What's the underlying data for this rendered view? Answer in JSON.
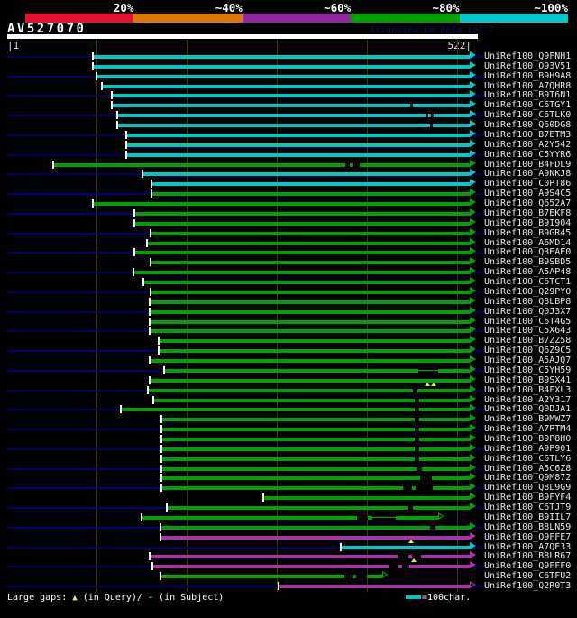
{
  "scale_bar": {
    "segments": [
      {
        "label": "20%",
        "color": "#e81030"
      },
      {
        "label": "~40%",
        "color": "#d97700"
      },
      {
        "label": "~60%",
        "color": "#8e2a9e"
      },
      {
        "label": "~80%",
        "color": "#00a000"
      },
      {
        "label": "~100%",
        "color": "#00c8c8"
      }
    ]
  },
  "header": {
    "query_id": "AV527070",
    "credit": "AlignView.pm Beta rel.7"
  },
  "ruler": {
    "start_label": "|1",
    "end_label": "522|",
    "query_length": 522
  },
  "colors": {
    "cyan": "#00c8c8",
    "green": "#00a000",
    "magenta": "#aa33aa",
    "query_line": "#000066",
    "gridline": "#3a3a00",
    "gap_marker_yellow": "#e8e860"
  },
  "footer": {
    "prefix": "Large gaps:",
    "query_marker": "▲",
    "query_text": "(in Query)/",
    "subject_marker": "-",
    "subject_text": " (in Subject)",
    "scale_text": "=100char."
  },
  "alignments": [
    {
      "id": "UniRef100_Q9FNH1",
      "identity": "cyan",
      "start": 103,
      "end": 521,
      "gaps": [],
      "markers": [],
      "hollow": false
    },
    {
      "id": "UniRef100_Q93V51",
      "identity": "cyan",
      "start": 103,
      "end": 521,
      "gaps": [],
      "markers": [],
      "hollow": false
    },
    {
      "id": "UniRef100_B9H9A8",
      "identity": "cyan",
      "start": 107,
      "end": 521,
      "gaps": [],
      "markers": [],
      "hollow": false
    },
    {
      "id": "UniRef100_A7QHR8",
      "identity": "cyan",
      "start": 113,
      "end": 521,
      "gaps": [],
      "markers": [],
      "hollow": false
    },
    {
      "id": "UniRef100_B9T6N1",
      "identity": "cyan",
      "start": 124,
      "end": 521,
      "gaps": [],
      "markers": [],
      "hollow": false
    },
    {
      "id": "UniRef100_C6TGY1",
      "identity": "cyan",
      "start": 124,
      "end": 521,
      "gaps": [
        [
          455,
          3
        ]
      ],
      "markers": [],
      "hollow": false
    },
    {
      "id": "UniRef100_C6TLK0",
      "identity": "cyan",
      "start": 130,
      "end": 521,
      "gaps": [
        [
          472,
          3
        ],
        [
          478,
          3
        ]
      ],
      "markers": [],
      "hollow": false
    },
    {
      "id": "UniRef100_Q60DG8",
      "identity": "cyan",
      "start": 130,
      "end": 521,
      "gaps": [
        [
          477,
          3
        ]
      ],
      "markers": [],
      "hollow": false
    },
    {
      "id": "UniRef100_B7ETM3",
      "identity": "cyan",
      "start": 140,
      "end": 521,
      "gaps": [],
      "markers": [],
      "hollow": false
    },
    {
      "id": "UniRef100_A2Y542",
      "identity": "cyan",
      "start": 140,
      "end": 521,
      "gaps": [],
      "markers": [],
      "hollow": false
    },
    {
      "id": "UniRef100_C5YYR6",
      "identity": "cyan",
      "start": 140,
      "end": 521,
      "gaps": [],
      "markers": [],
      "hollow": false
    },
    {
      "id": "UniRef100_B4FDL9",
      "identity": "green",
      "start": 59,
      "end": 521,
      "gaps": [
        [
          383,
          5
        ],
        [
          391,
          8
        ]
      ],
      "markers": [],
      "hollow": false
    },
    {
      "id": "UniRef100_A9NKJ8",
      "identity": "cyan",
      "start": 158,
      "end": 521,
      "gaps": [],
      "markers": [],
      "hollow": false
    },
    {
      "id": "UniRef100_C0PT86",
      "identity": "cyan",
      "start": 168,
      "end": 521,
      "gaps": [],
      "markers": [],
      "hollow": false
    },
    {
      "id": "UniRef100_A9S4C5",
      "identity": "green",
      "start": 168,
      "end": 521,
      "gaps": [],
      "markers": [],
      "hollow": false
    },
    {
      "id": "UniRef100_Q652A7",
      "identity": "green",
      "start": 103,
      "end": 521,
      "gaps": [],
      "markers": [],
      "hollow": false
    },
    {
      "id": "UniRef100_B7EKF8",
      "identity": "green",
      "start": 149,
      "end": 521,
      "gaps": [],
      "markers": [],
      "hollow": false
    },
    {
      "id": "UniRef100_B9I904",
      "identity": "green",
      "start": 149,
      "end": 521,
      "gaps": [],
      "markers": [],
      "hollow": false
    },
    {
      "id": "UniRef100_B9GR45",
      "identity": "green",
      "start": 167,
      "end": 521,
      "gaps": [],
      "markers": [],
      "hollow": false
    },
    {
      "id": "UniRef100_A6MD14",
      "identity": "green",
      "start": 163,
      "end": 521,
      "gaps": [],
      "markers": [],
      "hollow": false
    },
    {
      "id": "UniRef100_Q3EAE0",
      "identity": "green",
      "start": 149,
      "end": 521,
      "gaps": [],
      "markers": [],
      "hollow": false
    },
    {
      "id": "UniRef100_B9SBD5",
      "identity": "green",
      "start": 167,
      "end": 521,
      "gaps": [],
      "markers": [],
      "hollow": false
    },
    {
      "id": "UniRef100_A5AP48",
      "identity": "green",
      "start": 148,
      "end": 521,
      "gaps": [],
      "markers": [],
      "hollow": false
    },
    {
      "id": "UniRef100_C6TCT1",
      "identity": "green",
      "start": 159,
      "end": 521,
      "gaps": [],
      "markers": [],
      "hollow": false
    },
    {
      "id": "UniRef100_Q29PY0",
      "identity": "green",
      "start": 167,
      "end": 521,
      "gaps": [],
      "markers": [],
      "hollow": false
    },
    {
      "id": "UniRef100_Q8LBP8",
      "identity": "green",
      "start": 166,
      "end": 521,
      "gaps": [],
      "markers": [],
      "hollow": false
    },
    {
      "id": "UniRef100_Q0J3X7",
      "identity": "green",
      "start": 166,
      "end": 521,
      "gaps": [],
      "markers": [],
      "hollow": false
    },
    {
      "id": "UniRef100_C6T4G5",
      "identity": "green",
      "start": 166,
      "end": 521,
      "gaps": [],
      "markers": [],
      "hollow": false
    },
    {
      "id": "UniRef100_C5X643",
      "identity": "green",
      "start": 166,
      "end": 521,
      "gaps": [],
      "markers": [],
      "hollow": false
    },
    {
      "id": "UniRef100_B7ZZ58",
      "identity": "green",
      "start": 176,
      "end": 521,
      "gaps": [],
      "markers": [],
      "hollow": false
    },
    {
      "id": "UniRef100_Q6Z9C5",
      "identity": "green",
      "start": 176,
      "end": 521,
      "gaps": [],
      "markers": [],
      "hollow": false
    },
    {
      "id": "UniRef100_A5AJQ7",
      "identity": "green",
      "start": 166,
      "end": 521,
      "gaps": [],
      "markers": [],
      "hollow": false
    },
    {
      "id": "UniRef100_C5YH59",
      "identity": "green",
      "start": 182,
      "end": 521,
      "gaps": [
        [
          464,
          22,
          "line"
        ]
      ],
      "markers": [],
      "hollow": false
    },
    {
      "id": "UniRef100_B9SX41",
      "identity": "green",
      "start": 166,
      "end": 521,
      "gaps": [],
      "markers": [
        474,
        481
      ],
      "hollow": false
    },
    {
      "id": "UniRef100_B4FXL3",
      "identity": "green",
      "start": 164,
      "end": 521,
      "gaps": [
        [
          458,
          5
        ]
      ],
      "markers": [],
      "hollow": false
    },
    {
      "id": "UniRef100_A2Y317",
      "identity": "green",
      "start": 170,
      "end": 521,
      "gaps": [
        [
          460,
          5
        ]
      ],
      "markers": [],
      "hollow": false
    },
    {
      "id": "UniRef100_Q0DJA1",
      "identity": "green",
      "start": 134,
      "end": 521,
      "gaps": [
        [
          460,
          5
        ]
      ],
      "markers": [],
      "hollow": false
    },
    {
      "id": "UniRef100_B9MWZ7",
      "identity": "green",
      "start": 179,
      "end": 521,
      "gaps": [
        [
          460,
          5
        ]
      ],
      "markers": [],
      "hollow": false
    },
    {
      "id": "UniRef100_A7PTM4",
      "identity": "green",
      "start": 179,
      "end": 521,
      "gaps": [
        [
          460,
          5
        ]
      ],
      "markers": [],
      "hollow": false
    },
    {
      "id": "UniRef100_B9P8H0",
      "identity": "green",
      "start": 179,
      "end": 521,
      "gaps": [
        [
          460,
          5
        ]
      ],
      "markers": [],
      "hollow": false
    },
    {
      "id": "UniRef100_A9P901",
      "identity": "green",
      "start": 179,
      "end": 521,
      "gaps": [
        [
          460,
          5
        ]
      ],
      "markers": [],
      "hollow": false
    },
    {
      "id": "UniRef100_C6TLY6",
      "identity": "green",
      "start": 179,
      "end": 521,
      "gaps": [
        [
          460,
          5
        ]
      ],
      "markers": [],
      "hollow": false
    },
    {
      "id": "UniRef100_A5C6Z8",
      "identity": "green",
      "start": 179,
      "end": 521,
      "gaps": [
        [
          462,
          6
        ]
      ],
      "markers": [],
      "hollow": false
    },
    {
      "id": "UniRef100_Q9M872",
      "identity": "green",
      "start": 179,
      "end": 521,
      "gaps": [
        [
          466,
          13
        ]
      ],
      "markers": [],
      "hollow": false
    },
    {
      "id": "UniRef100_Q8L9G9",
      "identity": "green",
      "start": 179,
      "end": 521,
      "gaps": [
        [
          447,
          10
        ],
        [
          461,
          19
        ]
      ],
      "markers": [],
      "hollow": false
    },
    {
      "id": "UniRef100_B9FYF4",
      "identity": "green",
      "start": 292,
      "end": 521,
      "gaps": [],
      "markers": [],
      "hollow": false
    },
    {
      "id": "UniRef100_C6TJT9",
      "identity": "green",
      "start": 185,
      "end": 521,
      "gaps": [
        [
          452,
          6
        ]
      ],
      "markers": [],
      "hollow": false
    },
    {
      "id": "UniRef100_B9IIL7",
      "identity": "green",
      "start": 157,
      "end": 486,
      "gaps": [
        [
          396,
          12
        ],
        [
          413,
          26,
          "line"
        ]
      ],
      "markers": [],
      "hollow": true
    },
    {
      "id": "UniRef100_B8LN59",
      "identity": "green",
      "start": 178,
      "end": 521,
      "gaps": [
        [
          477,
          6
        ]
      ],
      "markers": [],
      "hollow": false
    },
    {
      "id": "UniRef100_Q9FFE7",
      "identity": "magenta",
      "start": 178,
      "end": 521,
      "gaps": [],
      "markers": [
        456
      ],
      "hollow": false
    },
    {
      "id": "UniRef100_A7QE33",
      "identity": "cyan",
      "start": 378,
      "end": 521,
      "gaps": [],
      "markers": [],
      "hollow": false
    },
    {
      "id": "UniRef100_B8LR67",
      "identity": "magenta",
      "start": 166,
      "end": 521,
      "gaps": [
        [
          441,
          12
        ],
        [
          457,
          10
        ]
      ],
      "markers": [
        459
      ],
      "hollow": false
    },
    {
      "id": "UniRef100_Q9FFF0",
      "identity": "magenta",
      "start": 169,
      "end": 521,
      "gaps": [
        [
          432,
          10
        ],
        [
          446,
          8
        ]
      ],
      "markers": [],
      "hollow": false
    },
    {
      "id": "UniRef100_C6TFU2",
      "identity": "green",
      "start": 178,
      "end": 424,
      "gaps": [
        [
          382,
          9
        ],
        [
          395,
          12
        ]
      ],
      "markers": [],
      "hollow": true
    },
    {
      "id": "UniRef100_Q2R0T3",
      "identity": "magenta",
      "start": 309,
      "end": 521,
      "gaps": [],
      "markers": [],
      "hollow": true
    }
  ]
}
